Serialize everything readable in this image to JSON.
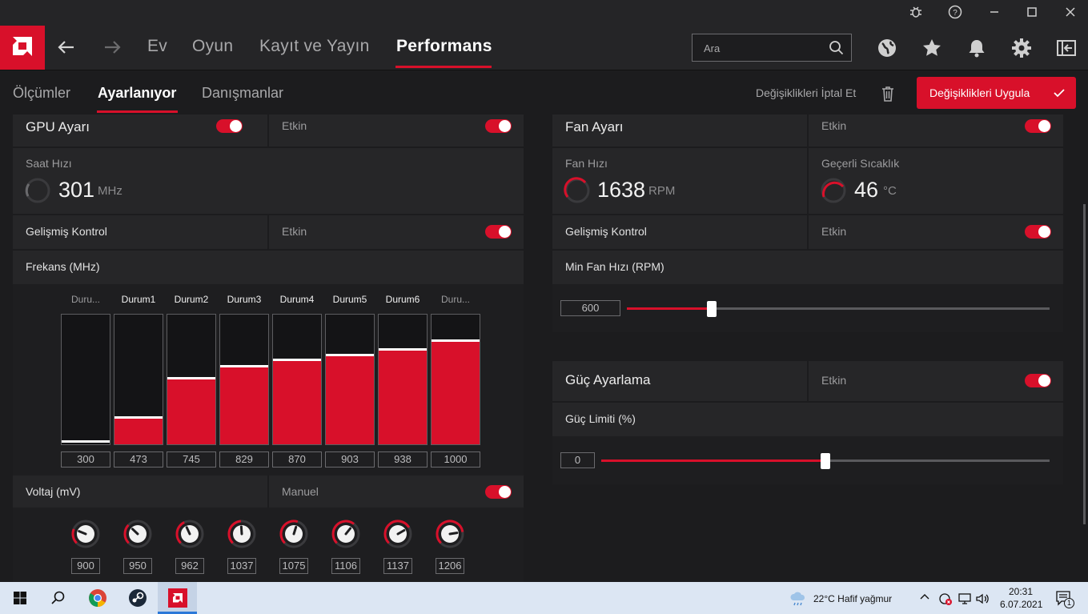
{
  "nav": {
    "tabs": [
      {
        "label": "Ev"
      },
      {
        "label": "Oyun"
      },
      {
        "label": "Kayıt ve Yayın"
      },
      {
        "label": "Performans"
      }
    ],
    "search_placeholder": "Ara"
  },
  "subnav": {
    "tabs": [
      {
        "label": "Ölçümler"
      },
      {
        "label": "Ayarlanıyor"
      },
      {
        "label": "Danışmanlar"
      }
    ],
    "discard_label": "Değişiklikleri İptal Et",
    "apply_label": "Değişiklikleri Uygula"
  },
  "gpu": {
    "title": "GPU Ayarı",
    "status": "Etkin",
    "clock_label": "Saat Hızı",
    "clock_value": "301",
    "clock_unit": "MHz",
    "advanced_label": "Gelişmiş Kontrol",
    "advanced_status": "Etkin",
    "freq_label": "Frekans (MHz)",
    "states": [
      {
        "label": "Duru...",
        "freq": "300",
        "fill": 0.0
      },
      {
        "label": "Durum1",
        "freq": "473",
        "fill": 0.2
      },
      {
        "label": "Durum2",
        "freq": "745",
        "fill": 0.5
      },
      {
        "label": "Durum3",
        "freq": "829",
        "fill": 0.59
      },
      {
        "label": "Durum4",
        "freq": "870",
        "fill": 0.64
      },
      {
        "label": "Durum5",
        "freq": "903",
        "fill": 0.68
      },
      {
        "label": "Durum6",
        "freq": "938",
        "fill": 0.72
      },
      {
        "label": "Duru...",
        "freq": "1000",
        "fill": 0.79
      }
    ],
    "voltage_label": "Voltaj (mV)",
    "voltage_mode": "Manuel",
    "voltages": [
      "900",
      "950",
      "962",
      "1037",
      "1075",
      "1106",
      "1137",
      "1206"
    ]
  },
  "fan": {
    "title": "Fan Ayarı",
    "status": "Etkin",
    "speed_label": "Fan Hızı",
    "speed_value": "1638",
    "speed_unit": "RPM",
    "temp_label": "Geçerli Sıcaklık",
    "temp_value": "46",
    "temp_unit": "°C",
    "advanced_label": "Gelişmiş Kontrol",
    "advanced_status": "Etkin",
    "min_label": "Min Fan Hızı (RPM)",
    "min_value": "600",
    "min_fraction": 0.2
  },
  "power": {
    "title": "Güç Ayarlama",
    "status": "Etkin",
    "limit_label": "Güç Limiti (%)",
    "limit_value": "0",
    "limit_fraction": 0.5
  },
  "taskbar": {
    "weather": "22°C  Hafif yağmur",
    "time": "20:31",
    "date": "6.07.2021",
    "notif_count": "1"
  },
  "colors": {
    "accent": "#d8102a",
    "panel": "#262628",
    "background": "#1c1c1e"
  }
}
